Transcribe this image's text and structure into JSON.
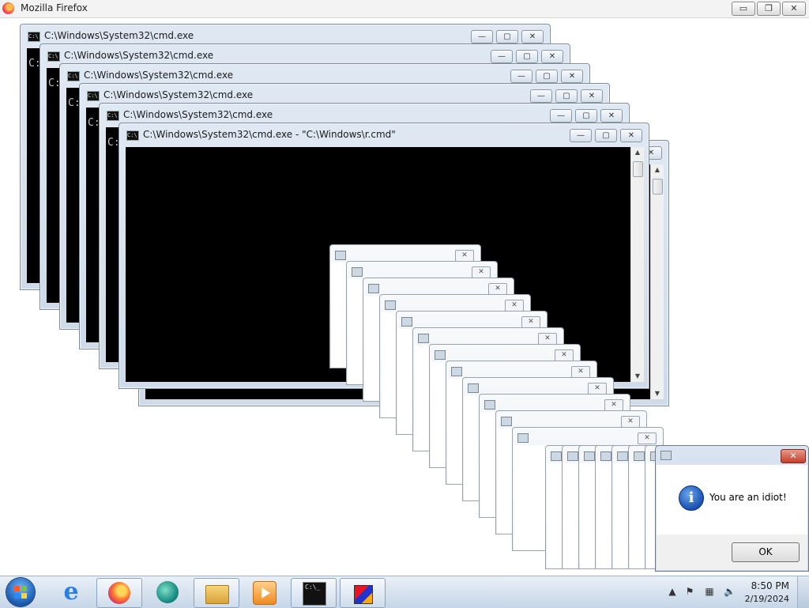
{
  "browser": {
    "title": "Mozilla Firefox",
    "minimize_glyph": "▭",
    "restore_glyph": "❐",
    "close_glyph": "✕"
  },
  "cmd_windows": {
    "plain_title": "C:\\Windows\\System32\\cmd.exe",
    "front_title": "C:\\Windows\\System32\\cmd.exe - \"C:\\Windows\\r.cmd\"",
    "prompt": "C:",
    "icon_text": "C:\\",
    "minimize_glyph": "—",
    "maximize_glyph": "▢",
    "close_glyph": "✕",
    "scroll_up": "▲",
    "scroll_down": "▼"
  },
  "popups": {
    "close_glyph": "✕"
  },
  "alert": {
    "message": "You are an idiot!",
    "icon_letter": "i",
    "ok_label": "OK",
    "close_glyph": "✕"
  },
  "taskbar": {
    "pinned_icons": [
      "start-orb",
      "ie-icon",
      "firefox-icon",
      "media-center-icon",
      "folder-icon",
      "media-player-icon",
      "cmd-icon",
      "setup-icon"
    ],
    "cmd_icon_text": "C:\\_",
    "ie_glyph": "e",
    "tray": {
      "show_hidden_glyph": "▲",
      "flag_glyph": "⚑",
      "network_glyph": "▦",
      "volume_glyph": "🔈"
    },
    "clock_time": "8:50 PM",
    "clock_date": "2/19/2024"
  },
  "colors": {
    "console_bg": "#000000",
    "alert_close": "#c6402a",
    "info_icon": "#1a4fb0"
  }
}
